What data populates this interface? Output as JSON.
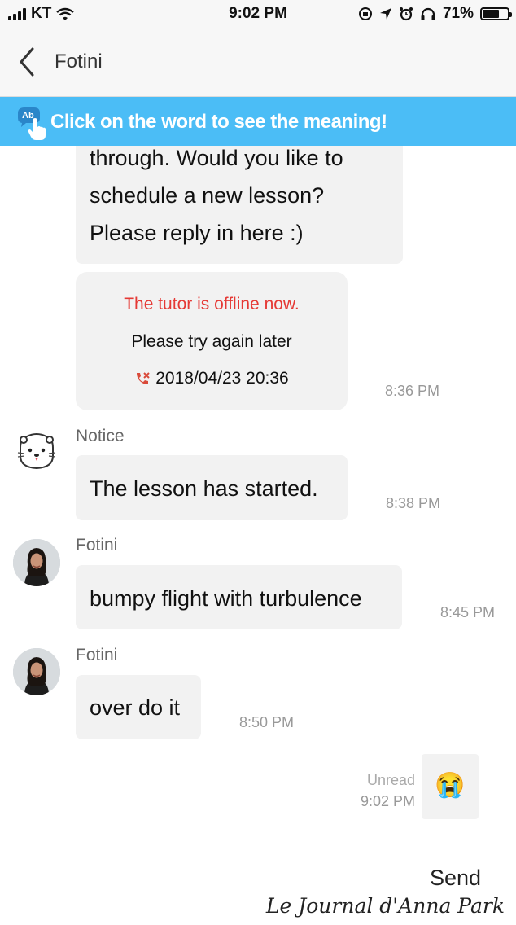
{
  "status_bar": {
    "carrier": "KT",
    "time": "9:02 PM",
    "battery": "71%",
    "battery_level": 0.71,
    "icons": [
      "signal-icon",
      "wifi-icon",
      "lock-rotation-icon",
      "location-icon",
      "alarm-icon",
      "headphones-icon",
      "battery-icon"
    ]
  },
  "header": {
    "back_icon": "chevron-left-icon",
    "title": "Fotini"
  },
  "banner": {
    "icon": "tap-dictionary-icon",
    "text": "Click on the word to see the meaning!"
  },
  "messages": [
    {
      "type": "incoming",
      "lines": [
        "through. Would you like to",
        "schedule a new lesson?",
        "Please reply in here :)"
      ]
    },
    {
      "type": "system-card",
      "offline_text": "The tutor is offline now.",
      "retry_text": "Please try again later",
      "call_icon": "missed-call-icon",
      "call_datetime": "2018/04/23 20:36",
      "time": "8:36 PM"
    },
    {
      "type": "incoming",
      "sender": "Notice",
      "avatar": "otter-mascot-icon",
      "text": "The lesson has started.",
      "time": "8:38 PM"
    },
    {
      "type": "incoming",
      "sender": "Fotini",
      "avatar": "tutor-avatar",
      "text": "bumpy flight with turbulence",
      "time": "8:45 PM"
    },
    {
      "type": "incoming",
      "sender": "Fotini",
      "avatar": "tutor-avatar",
      "text": "over do it",
      "time": "8:50 PM"
    },
    {
      "type": "outgoing",
      "status": "Unread",
      "time": "9:02 PM",
      "emoji": "😭"
    }
  ],
  "composer": {
    "send_label": "Send"
  },
  "watermark": "Le Journal d'Anna Park",
  "colors": {
    "banner": "#4bbdf6",
    "offline_red": "#e53935",
    "bubble": "#f2f2f2"
  }
}
